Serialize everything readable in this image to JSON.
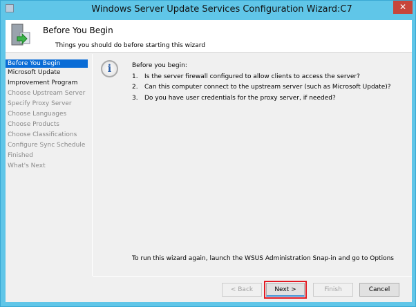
{
  "window": {
    "title": "Windows Server Update Services Configuration Wizard:C7",
    "close_label": "✕"
  },
  "header": {
    "title": "Before You Begin",
    "subtitle": "Things you should do before starting this wizard"
  },
  "sidebar": {
    "items": [
      {
        "label": "Before You Begin",
        "state": "active"
      },
      {
        "label": "Microsoft Update",
        "state": "enabled"
      },
      {
        "label": "Improvement Program",
        "state": "enabled"
      },
      {
        "label": "Choose Upstream Server",
        "state": "disabled"
      },
      {
        "label": "Specify Proxy Server",
        "state": "disabled"
      },
      {
        "label": "Choose Languages",
        "state": "disabled"
      },
      {
        "label": "Choose Products",
        "state": "disabled"
      },
      {
        "label": "Choose Classifications",
        "state": "disabled"
      },
      {
        "label": "Configure Sync Schedule",
        "state": "disabled"
      },
      {
        "label": "Finished",
        "state": "disabled"
      },
      {
        "label": "What's Next",
        "state": "disabled"
      }
    ]
  },
  "main": {
    "intro": "Before you begin:",
    "questions": [
      {
        "num": "1.",
        "text": "Is the server firewall configured to allow clients to access the server?"
      },
      {
        "num": "2.",
        "text": "Can this computer connect to the upstream server (such as Microsoft Update)?"
      },
      {
        "num": "3.",
        "text": "Do you have user credentials for the proxy server, if needed?"
      }
    ],
    "note": "To run this wizard again, launch the WSUS Administration Snap-in and go to Options"
  },
  "buttons": {
    "back": "< Back",
    "next": "Next >",
    "finish": "Finish",
    "cancel": "Cancel"
  }
}
